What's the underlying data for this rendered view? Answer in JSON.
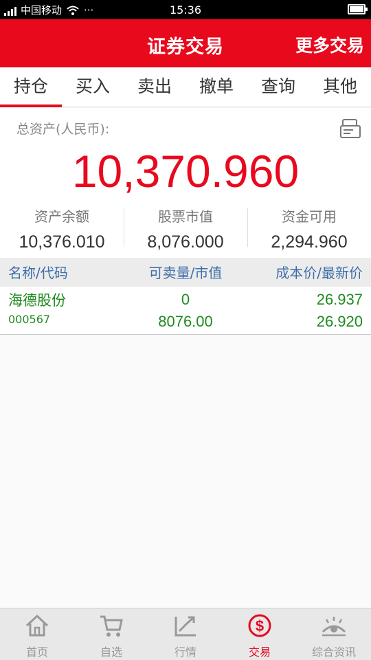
{
  "statusbar": {
    "carrier": "中国移动",
    "dots": "···",
    "time": "15:36"
  },
  "header": {
    "title": "证券交易",
    "more": "更多交易"
  },
  "tabs": [
    {
      "label": "持仓",
      "active": true
    },
    {
      "label": "买入"
    },
    {
      "label": "卖出"
    },
    {
      "label": "撤单"
    },
    {
      "label": "查询"
    },
    {
      "label": "其他"
    }
  ],
  "asset": {
    "label": "总资产(人民币):",
    "total": "10,370.960",
    "items": [
      {
        "key": "资产余额",
        "value": "10,376.010"
      },
      {
        "key": "股票市值",
        "value": "8,076.000"
      },
      {
        "key": "资金可用",
        "value": "2,294.960"
      }
    ]
  },
  "table": {
    "headers": [
      "名称/代码",
      "可卖量/市值",
      "成本价/最新价"
    ],
    "rows": [
      {
        "name": "海德股份",
        "code": "000567",
        "sellable": "0",
        "market_value": "8076.00",
        "cost": "26.937",
        "latest": "26.920"
      }
    ]
  },
  "nav": [
    {
      "label": "首页",
      "icon": "home-icon"
    },
    {
      "label": "自选",
      "icon": "cart-icon"
    },
    {
      "label": "行情",
      "icon": "trend-icon"
    },
    {
      "label": "交易",
      "icon": "dollar-icon",
      "active": true
    },
    {
      "label": "综合资讯",
      "icon": "eye-icon"
    }
  ],
  "colors": {
    "brand": "#e8091d",
    "up_green": "#1f8a1f",
    "header_blue": "#3d6ea8"
  }
}
